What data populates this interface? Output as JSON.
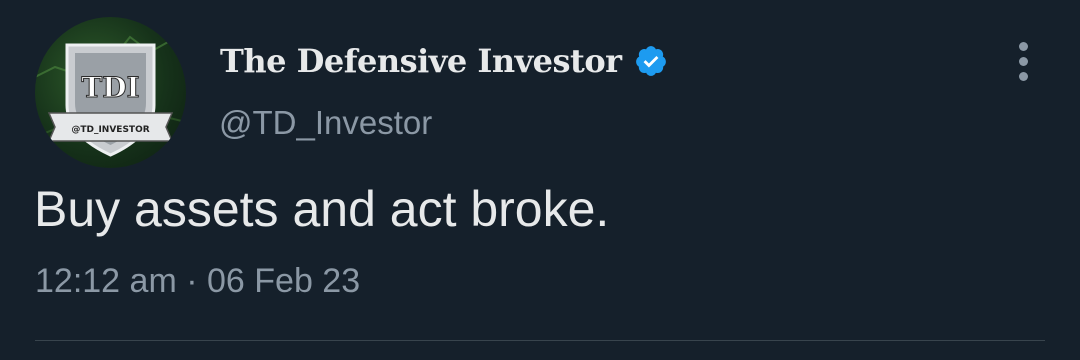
{
  "author": {
    "display_name": "The Defensive Investor",
    "handle": "@TD_Investor",
    "avatar_icon": "shield-logo-icon",
    "avatar_logo_text": "TDI",
    "avatar_ribbon_text": "@TD_INVESTOR",
    "verified_icon": "verified-badge-icon",
    "verified_color": "#1d9bf0"
  },
  "tweet": {
    "text": "Buy assets and act broke.",
    "time": "12:12 am",
    "separator": "·",
    "date": "06 Feb 23"
  },
  "menu": {
    "icon": "more-options-icon"
  },
  "colors": {
    "background": "#15202b",
    "primary_text": "#e7e9ea",
    "secondary_text": "#8b98a5",
    "divider": "#38444d"
  }
}
